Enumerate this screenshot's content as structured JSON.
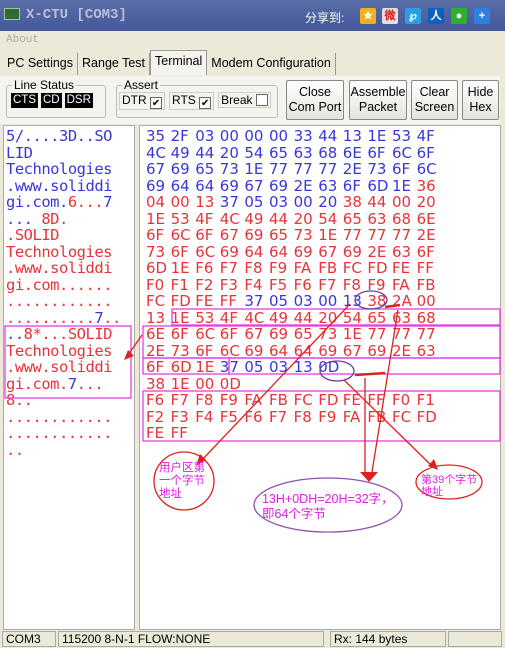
{
  "window": {
    "title": "X-CTU   [COM3]",
    "share_label": "分享到:",
    "share_icons": [
      "qzone-icon",
      "weibo-icon",
      "tencent-weibo-icon",
      "renren-icon",
      "wechat-icon",
      "more-plus-icon"
    ]
  },
  "menu": {
    "about": "About"
  },
  "tabs": [
    {
      "label": "PC Settings"
    },
    {
      "label": "Range Test"
    },
    {
      "label": "Terminal",
      "active": true
    },
    {
      "label": "Modem Configuration"
    }
  ],
  "line_status": {
    "label": "Line Status",
    "leds": [
      "CTS",
      "CD",
      "DSR"
    ]
  },
  "assert": {
    "label": "Assert",
    "items": [
      {
        "label": "DTR",
        "checked": true
      },
      {
        "label": "RTS",
        "checked": true
      },
      {
        "label": "Break",
        "checked": false
      }
    ]
  },
  "buttons": [
    {
      "line1": "Close",
      "line2": "Com Port"
    },
    {
      "line1": "Assemble",
      "line2": "Packet"
    },
    {
      "line1": "Clear",
      "line2": "Screen"
    },
    {
      "line1": "Hide",
      "line2": "Hex"
    }
  ],
  "ascii_lines": [
    [
      [
        "5/....3D..SO",
        "b"
      ]
    ],
    [
      [
        "LID",
        "b"
      ]
    ],
    [
      [
        "Technologies",
        "b"
      ]
    ],
    [
      [
        ".www.soliddi",
        "b"
      ]
    ],
    [
      [
        "gi.com.",
        "b"
      ],
      [
        "6...",
        "r"
      ],
      [
        "7",
        "b"
      ]
    ],
    [
      [
        "...",
        "b"
      ],
      [
        " 8D.",
        "r"
      ]
    ],
    [
      [
        ".SOLID",
        "r"
      ]
    ],
    [
      [
        "Technologies",
        "r"
      ]
    ],
    [
      [
        ".www.soliddi",
        "r"
      ]
    ],
    [
      [
        "gi.com......",
        "r"
      ]
    ],
    [
      [
        "............",
        "r"
      ]
    ],
    [
      [
        "..........",
        "r"
      ],
      [
        "7",
        "b"
      ],
      [
        "..",
        "r"
      ]
    ],
    [
      [
        "..",
        "b"
      ],
      [
        "8*...SOLID",
        "r"
      ]
    ],
    [
      [
        "Technologies",
        "r"
      ]
    ],
    [
      [
        ".www.soliddi",
        "r"
      ]
    ],
    [
      [
        "gi.com.",
        "r"
      ],
      [
        "7",
        "b"
      ],
      [
        "...",
        "r"
      ]
    ],
    [
      [
        "8..",
        "r"
      ]
    ],
    [
      [
        "............",
        "r"
      ]
    ],
    [
      [
        "............",
        "r"
      ]
    ],
    [
      [
        "..",
        "r"
      ]
    ]
  ],
  "hex_rows": [
    {
      "c": [
        "35",
        "2F",
        "03",
        "00",
        "00",
        "00",
        "33",
        "44",
        "13",
        "1E",
        "53",
        "4F"
      ],
      "blue": [
        0,
        1,
        2,
        3,
        4,
        5,
        6,
        7,
        8,
        9,
        10,
        11
      ]
    },
    {
      "c": [
        "4C",
        "49",
        "44",
        "20",
        "54",
        "65",
        "63",
        "68",
        "6E",
        "6F",
        "6C",
        "6F"
      ],
      "blue": [
        0,
        1,
        2,
        3,
        4,
        5,
        6,
        7,
        8,
        9,
        10,
        11
      ]
    },
    {
      "c": [
        "67",
        "69",
        "65",
        "73",
        "1E",
        "77",
        "77",
        "77",
        "2E",
        "73",
        "6F",
        "6C"
      ],
      "blue": [
        0,
        1,
        2,
        3,
        4,
        5,
        6,
        7,
        8,
        9,
        10,
        11
      ]
    },
    {
      "c": [
        "69",
        "64",
        "64",
        "69",
        "67",
        "69",
        "2E",
        "63",
        "6F",
        "6D",
        "1E",
        "36"
      ],
      "blue": [
        0,
        1,
        2,
        3,
        4,
        5,
        6,
        7,
        8,
        9,
        10
      ]
    },
    {
      "c": [
        "04",
        "00",
        "13",
        "37",
        "05",
        "03",
        "00",
        "20",
        "38",
        "44",
        "00",
        "20"
      ],
      "blue": [
        3,
        4,
        5,
        6,
        7
      ]
    },
    {
      "c": [
        "1E",
        "53",
        "4F",
        "4C",
        "49",
        "44",
        "20",
        "54",
        "65",
        "63",
        "68",
        "6E"
      ],
      "blue": []
    },
    {
      "c": [
        "6F",
        "6C",
        "6F",
        "67",
        "69",
        "65",
        "73",
        "1E",
        "77",
        "77",
        "77",
        "2E"
      ],
      "blue": []
    },
    {
      "c": [
        "73",
        "6F",
        "6C",
        "69",
        "64",
        "64",
        "69",
        "67",
        "69",
        "2E",
        "63",
        "6F"
      ],
      "blue": []
    },
    {
      "c": [
        "6D",
        "1E",
        "F6",
        "F7",
        "F8",
        "F9",
        "FA",
        "FB",
        "FC",
        "FD",
        "FE",
        "FF"
      ],
      "blue": []
    },
    {
      "c": [
        "F0",
        "F1",
        "F2",
        "F3",
        "F4",
        "F5",
        "F6",
        "F7",
        "F8",
        "F9",
        "FA",
        "FB"
      ],
      "blue": []
    },
    {
      "c": [
        "FC",
        "FD",
        "FE",
        "FF",
        "37",
        "05",
        "03",
        "00",
        "13",
        "38",
        "2A",
        "00"
      ],
      "blue": [
        4,
        5,
        6,
        7,
        8
      ]
    },
    {
      "c": [
        "13",
        "1E",
        "53",
        "4F",
        "4C",
        "49",
        "44",
        "20",
        "54",
        "65",
        "63",
        "68"
      ],
      "blue": []
    },
    {
      "c": [
        "6E",
        "6F",
        "6C",
        "6F",
        "67",
        "69",
        "65",
        "73",
        "1E",
        "77",
        "77",
        "77"
      ],
      "blue": []
    },
    {
      "c": [
        "2E",
        "73",
        "6F",
        "6C",
        "69",
        "64",
        "64",
        "69",
        "67",
        "69",
        "2E",
        "63"
      ],
      "blue": []
    },
    {
      "c": [
        "6F",
        "6D",
        "1E",
        "37",
        "05",
        "03",
        "13",
        "0D"
      ],
      "blue": [
        3,
        4,
        5,
        6,
        7
      ]
    },
    {
      "c": [
        "38",
        "1E",
        "00",
        "0D"
      ],
      "blue": []
    },
    {
      "c": [
        "F6",
        "F7",
        "F8",
        "F9",
        "FA",
        "FB",
        "FC",
        "FD",
        "FE",
        "FF",
        "F0",
        "F1"
      ],
      "blue": []
    },
    {
      "c": [
        "F2",
        "F3",
        "F4",
        "F5",
        "F6",
        "F7",
        "F8",
        "F9",
        "FA",
        "FB",
        "FC",
        "FD"
      ],
      "blue": []
    },
    {
      "c": [
        "FE",
        "FF"
      ],
      "blue": []
    }
  ],
  "annotations": {
    "user_area_first": "用户区第一个字节地址",
    "length_calc_line1": "13H+0DH=20H=32字，",
    "length_calc_line2": "即64个字节",
    "byte39": "第39个字节地址"
  },
  "status": {
    "port": "COM3",
    "settings": "115200 8-N-1  FLOW:NONE",
    "rx": "Rx: 144 bytes"
  },
  "colors": {
    "blue_text": "#3838d8",
    "red_text": "#e83438",
    "annotation": "#e020e0",
    "titlebar": "#4a5e9f"
  }
}
